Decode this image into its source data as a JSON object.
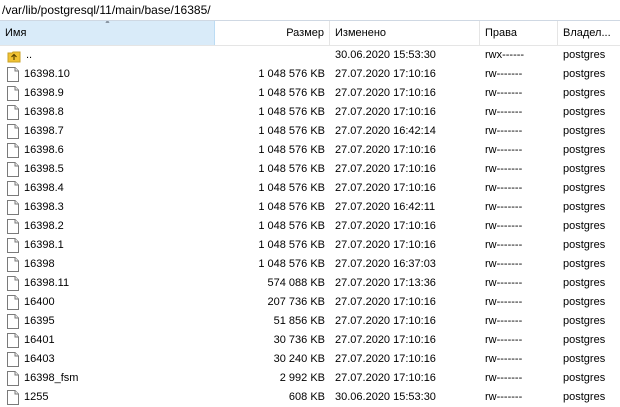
{
  "path": "/var/lib/postgresql/11/main/base/16385/",
  "columns": {
    "name": "Имя",
    "size": "Размер",
    "changed": "Изменено",
    "perm": "Права",
    "owner": "Владел..."
  },
  "up_row": {
    "name": "..",
    "size": "",
    "changed": "30.06.2020 15:53:30",
    "perm": "rwx------",
    "owner": "postgres",
    "icon": "folder-up-icon"
  },
  "files": [
    {
      "name": "16398.10",
      "size": "1 048 576 KB",
      "changed": "27.07.2020 17:10:16",
      "perm": "rw-------",
      "owner": "postgres"
    },
    {
      "name": "16398.9",
      "size": "1 048 576 KB",
      "changed": "27.07.2020 17:10:16",
      "perm": "rw-------",
      "owner": "postgres"
    },
    {
      "name": "16398.8",
      "size": "1 048 576 KB",
      "changed": "27.07.2020 17:10:16",
      "perm": "rw-------",
      "owner": "postgres"
    },
    {
      "name": "16398.7",
      "size": "1 048 576 KB",
      "changed": "27.07.2020 16:42:14",
      "perm": "rw-------",
      "owner": "postgres"
    },
    {
      "name": "16398.6",
      "size": "1 048 576 KB",
      "changed": "27.07.2020 17:10:16",
      "perm": "rw-------",
      "owner": "postgres"
    },
    {
      "name": "16398.5",
      "size": "1 048 576 KB",
      "changed": "27.07.2020 17:10:16",
      "perm": "rw-------",
      "owner": "postgres"
    },
    {
      "name": "16398.4",
      "size": "1 048 576 KB",
      "changed": "27.07.2020 17:10:16",
      "perm": "rw-------",
      "owner": "postgres"
    },
    {
      "name": "16398.3",
      "size": "1 048 576 KB",
      "changed": "27.07.2020 16:42:11",
      "perm": "rw-------",
      "owner": "postgres"
    },
    {
      "name": "16398.2",
      "size": "1 048 576 KB",
      "changed": "27.07.2020 17:10:16",
      "perm": "rw-------",
      "owner": "postgres"
    },
    {
      "name": "16398.1",
      "size": "1 048 576 KB",
      "changed": "27.07.2020 17:10:16",
      "perm": "rw-------",
      "owner": "postgres"
    },
    {
      "name": "16398",
      "size": "1 048 576 KB",
      "changed": "27.07.2020 16:37:03",
      "perm": "rw-------",
      "owner": "postgres"
    },
    {
      "name": "16398.11",
      "size": "574 088 KB",
      "changed": "27.07.2020 17:13:36",
      "perm": "rw-------",
      "owner": "postgres"
    },
    {
      "name": "16400",
      "size": "207 736 KB",
      "changed": "27.07.2020 17:10:16",
      "perm": "rw-------",
      "owner": "postgres"
    },
    {
      "name": "16395",
      "size": "51 856 KB",
      "changed": "27.07.2020 17:10:16",
      "perm": "rw-------",
      "owner": "postgres"
    },
    {
      "name": "16401",
      "size": "30 736 KB",
      "changed": "27.07.2020 17:10:16",
      "perm": "rw-------",
      "owner": "postgres"
    },
    {
      "name": "16403",
      "size": "30 240 KB",
      "changed": "27.07.2020 17:10:16",
      "perm": "rw-------",
      "owner": "postgres"
    },
    {
      "name": "16398_fsm",
      "size": "2 992 KB",
      "changed": "27.07.2020 17:10:16",
      "perm": "rw-------",
      "owner": "postgres"
    },
    {
      "name": "1255",
      "size": "608 KB",
      "changed": "30.06.2020 15:53:30",
      "perm": "rw-------",
      "owner": "postgres"
    }
  ],
  "icons": {
    "file": "file-icon",
    "up": "folder-up-icon",
    "sort": "sort-ascending-icon"
  },
  "colors": {
    "header_selected": "#d9ebf9",
    "folder_up": "#f1c232"
  }
}
